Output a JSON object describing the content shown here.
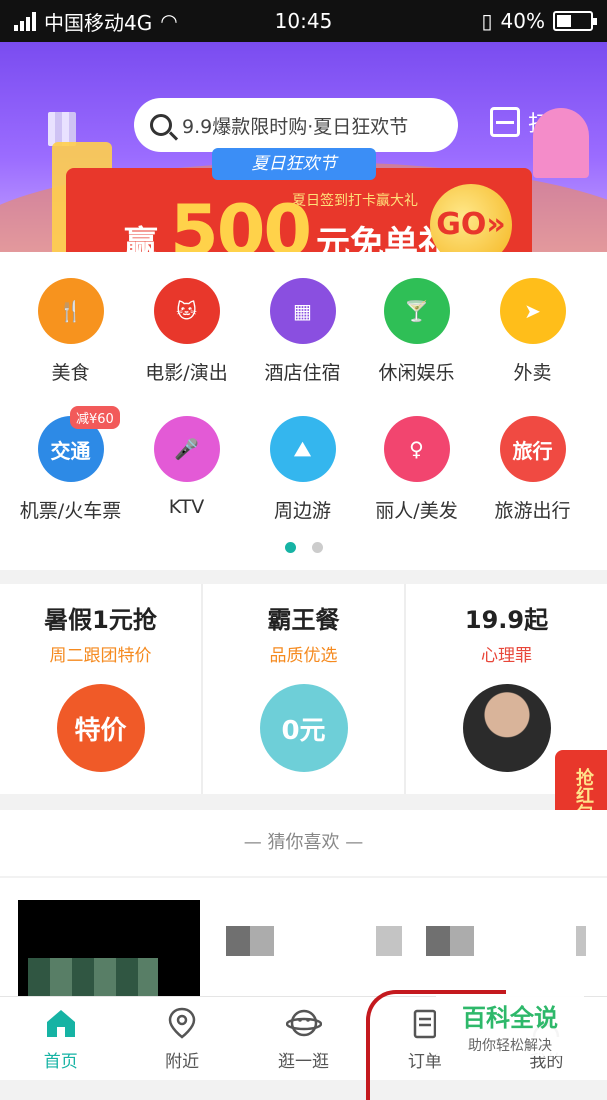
{
  "status_bar": {
    "carrier": "中国移动4G",
    "time": "10:45",
    "battery": "40%"
  },
  "header": {
    "search_placeholder": "9.9爆款限时购·夏日狂欢节",
    "scan_label": "扫码"
  },
  "banner": {
    "tag": "夏日狂欢节",
    "subtitle": "夏日签到打卡赢大礼",
    "prefix": "赢",
    "amount": "500",
    "suffix": "元免单礼",
    "go_label": "GO»"
  },
  "categories": [
    {
      "label": "美食",
      "icon": "fork-knife-icon",
      "color": "#f7931e",
      "glyph": "🍴"
    },
    {
      "label": "电影/演出",
      "icon": "cat-face-icon",
      "color": "#e8372b",
      "glyph": "🐱"
    },
    {
      "label": "酒店住宿",
      "icon": "building-icon",
      "color": "#8a4fe0",
      "glyph": "▦"
    },
    {
      "label": "休闲娱乐",
      "icon": "cocktail-icon",
      "color": "#2fbf56",
      "glyph": "🍸"
    },
    {
      "label": "外卖",
      "icon": "delivery-kangaroo-icon",
      "color": "#ffbe1a",
      "glyph": "➤"
    },
    {
      "label": "机票/火车票",
      "icon": "plane-icon",
      "color": "#2d8ae6",
      "glyph": "交通",
      "badge": "减¥60"
    },
    {
      "label": "KTV",
      "icon": "microphone-icon",
      "color": "#e35ad6",
      "glyph": "🎤"
    },
    {
      "label": "周边游",
      "icon": "landscape-icon",
      "color": "#34b6ee",
      "glyph": "⛰"
    },
    {
      "label": "丽人/美发",
      "icon": "woman-profile-icon",
      "color": "#f2456f",
      "glyph": "♀"
    },
    {
      "label": "旅游出行",
      "icon": "travel-icon",
      "color": "#f04a42",
      "glyph": "旅行"
    }
  ],
  "deals": [
    {
      "title": "暑假1元抢",
      "subtitle": "周二跟团特价",
      "pic_text": "特价",
      "pic_color": "#f05a28"
    },
    {
      "title": "霸王餐",
      "subtitle": "品质优选",
      "pic_text": "0元",
      "pic_color": "#6ecfd8"
    },
    {
      "title": "19.9起",
      "subtitle": "心理罪",
      "pic_text": "",
      "pic_color": "#3a3a3a"
    }
  ],
  "redpack": "抢红包",
  "guess_title": "— 猜你喜欢 —",
  "tabs": [
    {
      "label": "首页",
      "icon": "home-icon"
    },
    {
      "label": "附近",
      "icon": "location-pin-icon"
    },
    {
      "label": "逛一逛",
      "icon": "planet-icon"
    },
    {
      "label": "订单",
      "icon": "clipboard-icon"
    },
    {
      "label": "我的",
      "icon": "user-icon"
    }
  ],
  "watermark": {
    "title": "百科全说",
    "subtitle": "助你轻松解决"
  }
}
